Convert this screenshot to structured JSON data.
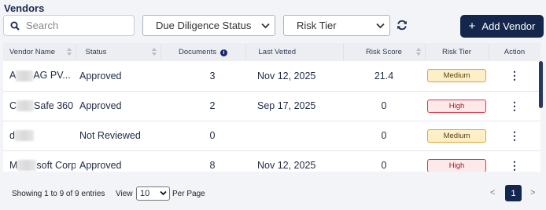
{
  "page": {
    "title": "Vendors"
  },
  "toolbar": {
    "search_placeholder": "Search",
    "due_diligence_label": "Due Diligence Status",
    "risk_tier_label": "Risk Tier",
    "add_vendor_label": "Add Vendor",
    "add_vendor_plus": "+"
  },
  "table": {
    "columns": [
      "Vendor Name",
      "Status",
      "Documents",
      "Last Vetted",
      "Risk Score",
      "Risk Tier",
      "Action"
    ],
    "rows": [
      {
        "name_prefix": "A",
        "name_suffix": "AG PV...",
        "status": "Approved",
        "documents": "3",
        "last_vetted": "Nov 12, 2025",
        "risk_score": "21.4",
        "risk_tier": "Medium"
      },
      {
        "name_prefix": "C",
        "name_suffix": "Safe 360",
        "status": "Approved",
        "documents": "2",
        "last_vetted": "Sep 17, 2025",
        "risk_score": "0",
        "risk_tier": "High"
      },
      {
        "name_prefix": "d",
        "name_suffix": "",
        "status": "Not Reviewed",
        "documents": "0",
        "last_vetted": "",
        "risk_score": "0",
        "risk_tier": "Medium"
      },
      {
        "name_prefix": "M",
        "name_suffix": "soft Corp",
        "status": "Approved",
        "documents": "8",
        "last_vetted": "Nov 12, 2025",
        "risk_score": "0",
        "risk_tier": "High"
      }
    ],
    "action_glyph": "⋮"
  },
  "footer": {
    "showing": "Showing 1 to 9 of 9 entries",
    "view_label": "View",
    "per_page_value": "10",
    "per_page_label": "Per Page",
    "prev": "<",
    "current_page": "1",
    "next": ">"
  },
  "colors": {
    "primary": "#15264d",
    "medium_bg": "#fdefc7",
    "medium_border": "#e0a524",
    "high_bg": "#fde8ea",
    "high_border": "#d93744"
  }
}
